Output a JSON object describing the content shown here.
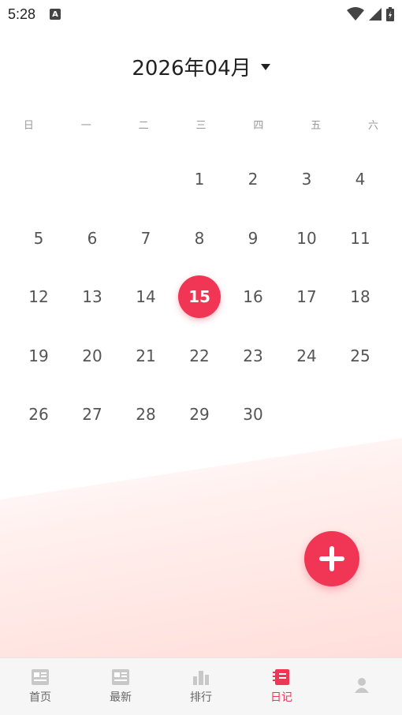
{
  "status_bar": {
    "time": "5:28",
    "notification_glyph": "A"
  },
  "calendar": {
    "month_title": "2026年04月",
    "weekdays": [
      "日",
      "一",
      "二",
      "三",
      "四",
      "五",
      "六"
    ],
    "leading_blanks": 3,
    "days": [
      "1",
      "2",
      "3",
      "4",
      "5",
      "6",
      "7",
      "8",
      "9",
      "10",
      "11",
      "12",
      "13",
      "14",
      "15",
      "16",
      "17",
      "18",
      "19",
      "20",
      "21",
      "22",
      "23",
      "24",
      "25",
      "26",
      "27",
      "28",
      "29",
      "30"
    ],
    "selected_day": "15"
  },
  "tabbar": {
    "tabs": [
      {
        "label": "首页",
        "icon": "news-card-icon",
        "active": false
      },
      {
        "label": "最新",
        "icon": "news-card-icon",
        "active": false
      },
      {
        "label": "排行",
        "icon": "bar-chart-icon",
        "active": false
      },
      {
        "label": "日记",
        "icon": "notebook-icon",
        "active": true
      },
      {
        "label": "",
        "icon": "person-icon",
        "active": false
      }
    ]
  },
  "colors": {
    "accent": "#f03654",
    "tab_inactive": "#666666"
  }
}
